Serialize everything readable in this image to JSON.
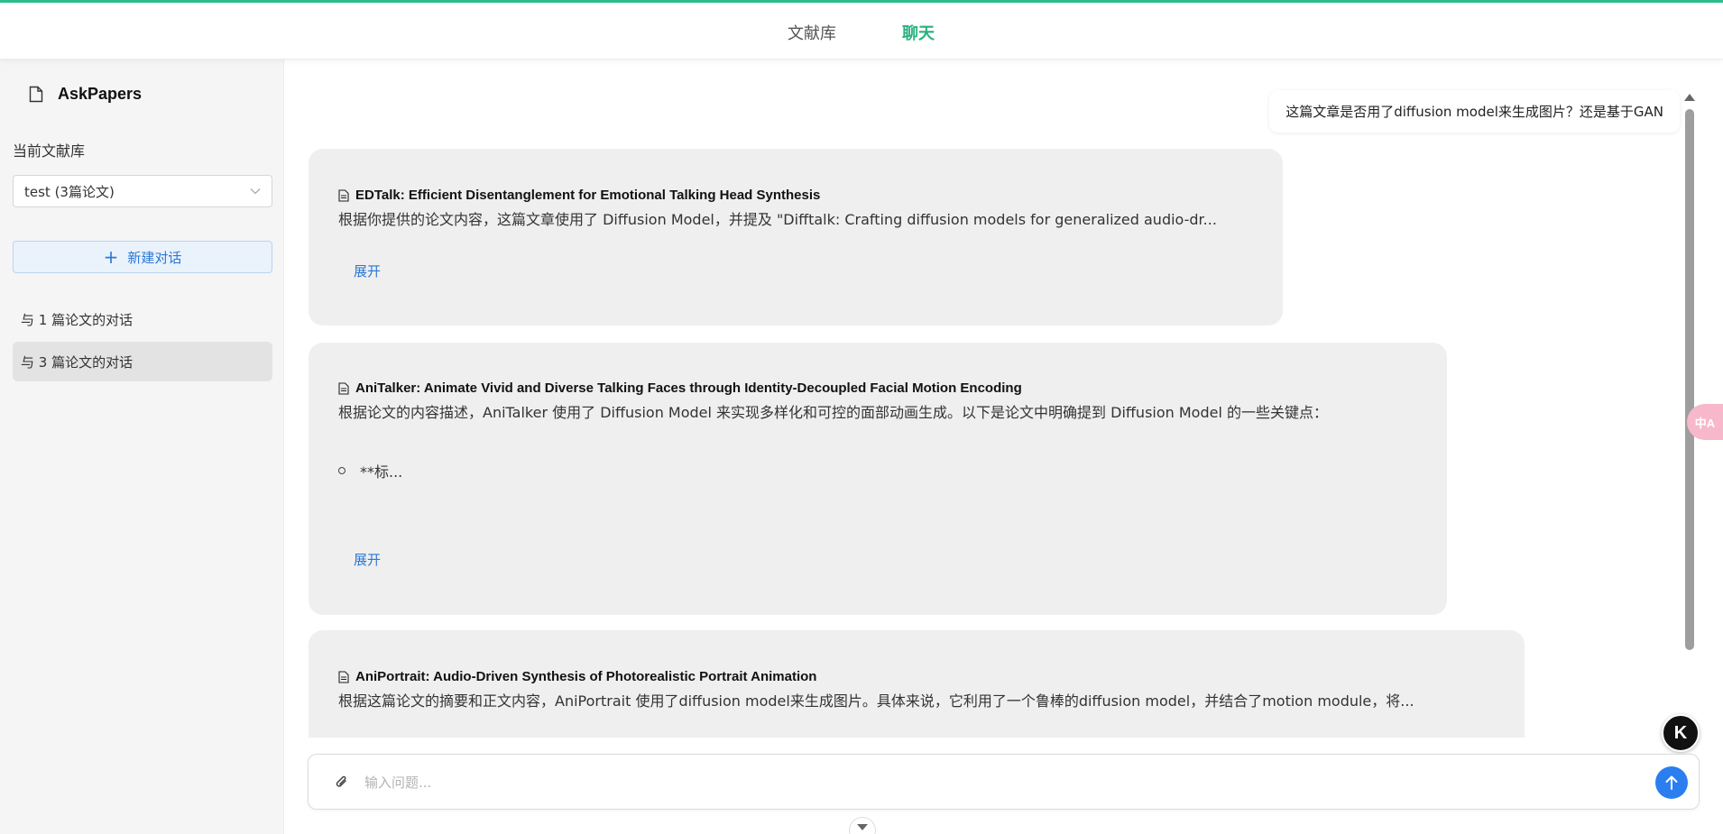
{
  "nav": {
    "tabs": [
      {
        "label": "文献库",
        "active": false
      },
      {
        "label": "聊天",
        "active": true
      }
    ],
    "active_color": "#2bb07f"
  },
  "sidebar": {
    "app_name": "AskPapers",
    "library_label": "当前文献库",
    "library_selected": "test (3篇论文)",
    "new_chat_label": "新建对话",
    "conversations": [
      {
        "label": "与 1 篇论文的对话",
        "active": false
      },
      {
        "label": "与 3 篇论文的对话",
        "active": true
      }
    ]
  },
  "chat": {
    "user_message": "这篇文章是否用了diffusion model来生成图片？还是基于GAN",
    "answers": [
      {
        "title": "EDTalk: Efficient Disentanglement for Emotional Talking Head Synthesis",
        "text": "根据你提供的论文内容，这篇文章使用了 Diffusion Model，并提及 \"Difftalk: Crafting diffusion models for generalized audio-dr...",
        "expand_label": "展开"
      },
      {
        "title": "AniTalker: Animate Vivid and Diverse Talking Faces through Identity-Decoupled Facial Motion Encoding",
        "text": "根据论文的内容描述，AniTalker 使用了 Diffusion Model 来实现多样化和可控的面部动画生成。以下是论文中明确提到 Diffusion Model 的一些关键点：",
        "bullet": "**标...",
        "expand_label": "展开"
      },
      {
        "title": "AniPortrait: Audio-Driven Synthesis of Photorealistic Portrait Animation",
        "text": "根据这篇论文的摘要和正文内容，AniPortrait 使用了diffusion model来生成图片。具体来说，它利用了一个鲁棒的diffusion model，并结合了motion module，将..."
      }
    ]
  },
  "input": {
    "placeholder": "输入问题..."
  },
  "widgets": {
    "translate_label": "中A",
    "k_label": "K"
  },
  "colors": {
    "accent_blue": "#2a7ef0",
    "top_border": "#2bbf8a"
  }
}
